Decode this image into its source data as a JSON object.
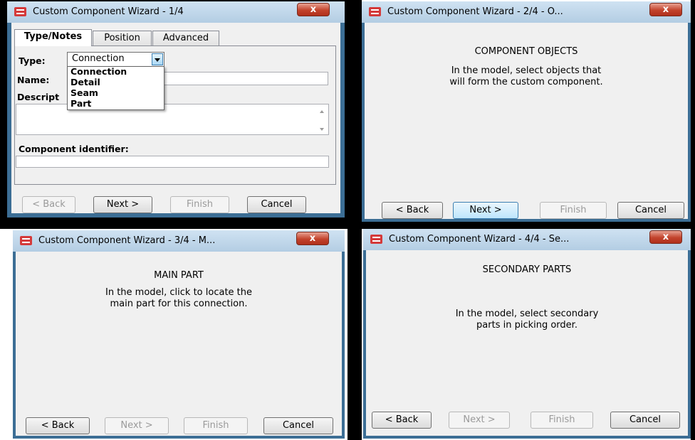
{
  "window1": {
    "title": "Custom Component Wizard - 1/4",
    "close_label": "x",
    "tabs": [
      "Type/Notes",
      "Position",
      "Advanced"
    ],
    "type_label": "Type:",
    "type_value": "Connection",
    "name_label": "Name:",
    "description_label": "Descript",
    "type_options": [
      "Connection",
      "Detail",
      "Seam",
      "Part"
    ],
    "component_identifier_label": "Component identifier:",
    "buttons": {
      "back": "< Back",
      "next": "Next >",
      "finish": "Finish",
      "cancel": "Cancel"
    }
  },
  "window2": {
    "title": "Custom Component Wizard - 2/4 - O...",
    "close_label": "x",
    "heading": "COMPONENT OBJECTS",
    "instruction_line1": "In the model, select objects that",
    "instruction_line2": "will form the custom component.",
    "buttons": {
      "back": "< Back",
      "next": "Next >",
      "finish": "Finish",
      "cancel": "Cancel"
    }
  },
  "window3": {
    "title": "Custom Component Wizard - 3/4 - M...",
    "close_label": "x",
    "heading": "MAIN PART",
    "instruction_line1": "In the model, click to locate the",
    "instruction_line2": "main part for this connection.",
    "buttons": {
      "back": "< Back",
      "next": "Next >",
      "finish": "Finish",
      "cancel": "Cancel"
    }
  },
  "window4": {
    "title": "Custom Component Wizard - 4/4 - Se...",
    "close_label": "x",
    "heading": "SECONDARY PARTS",
    "instruction_line1": "In the model, select secondary",
    "instruction_line2": "parts in picking order.",
    "buttons": {
      "back": "< Back",
      "next": "Next >",
      "finish": "Finish",
      "cancel": "Cancel"
    }
  }
}
